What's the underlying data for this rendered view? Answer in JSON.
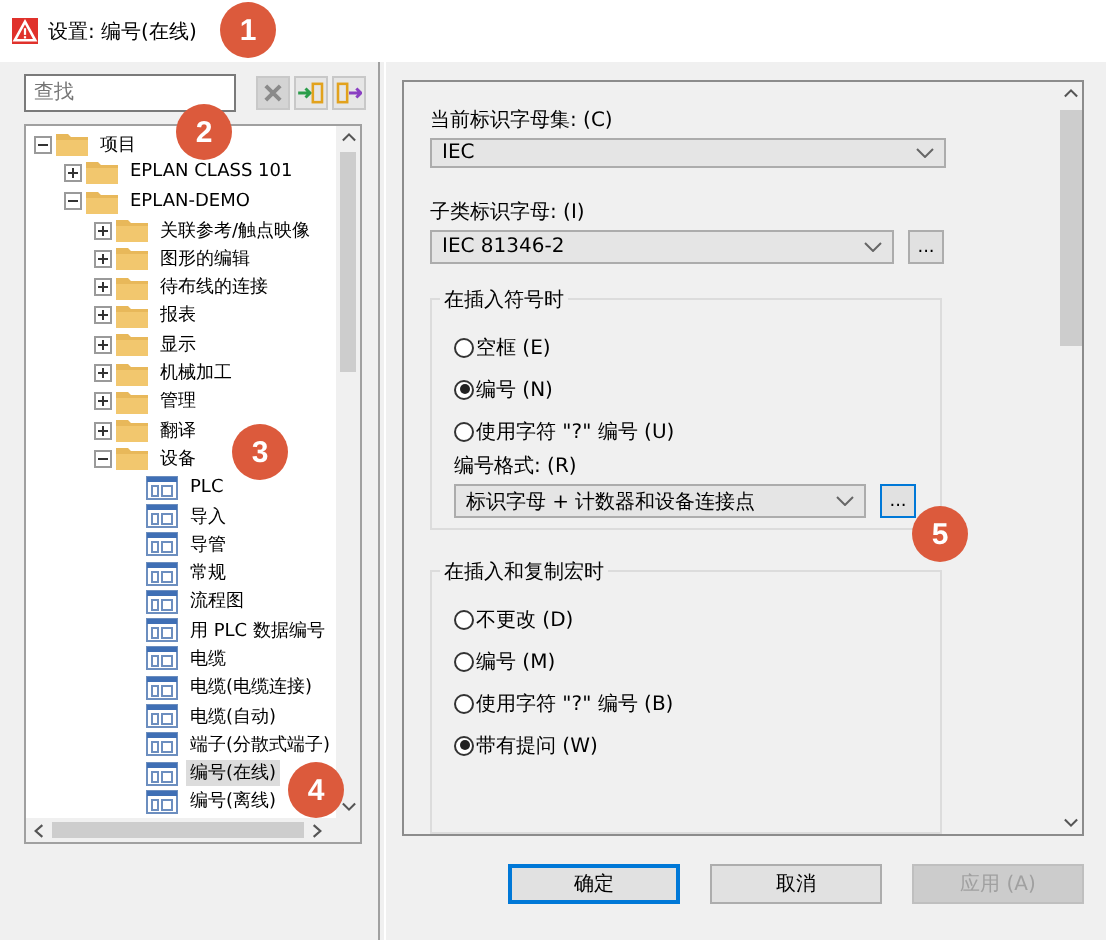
{
  "window": {
    "title": "设置: 编号(在线)"
  },
  "search": {
    "placeholder": "查找"
  },
  "tree": [
    {
      "label": "项目",
      "kind": "folder",
      "expanded": true,
      "selected": false,
      "children": [
        {
          "label": "EPLAN CLASS 101",
          "kind": "folder",
          "expanded": false,
          "selected": false
        },
        {
          "label": "EPLAN-DEMO",
          "kind": "folder",
          "expanded": true,
          "selected": false,
          "children": [
            {
              "label": "关联参考/触点映像",
              "kind": "folder",
              "expanded": false,
              "selected": false
            },
            {
              "label": "图形的编辑",
              "kind": "folder",
              "expanded": false,
              "selected": false
            },
            {
              "label": "待布线的连接",
              "kind": "folder",
              "expanded": false,
              "selected": false
            },
            {
              "label": "报表",
              "kind": "folder",
              "expanded": false,
              "selected": false
            },
            {
              "label": "显示",
              "kind": "folder",
              "expanded": false,
              "selected": false
            },
            {
              "label": "机械加工",
              "kind": "folder",
              "expanded": false,
              "selected": false
            },
            {
              "label": "管理",
              "kind": "folder",
              "expanded": false,
              "selected": false
            },
            {
              "label": "翻译",
              "kind": "folder",
              "expanded": false,
              "selected": false
            },
            {
              "label": "设备",
              "kind": "folder",
              "expanded": true,
              "selected": false,
              "children": [
                {
                  "label": "PLC",
                  "kind": "page",
                  "selected": false
                },
                {
                  "label": "导入",
                  "kind": "page",
                  "selected": false
                },
                {
                  "label": "导管",
                  "kind": "page",
                  "selected": false
                },
                {
                  "label": "常规",
                  "kind": "page",
                  "selected": false
                },
                {
                  "label": "流程图",
                  "kind": "page",
                  "selected": false
                },
                {
                  "label": "用 PLC 数据编号",
                  "kind": "page",
                  "selected": false
                },
                {
                  "label": "电缆",
                  "kind": "page",
                  "selected": false
                },
                {
                  "label": "电缆(电缆连接)",
                  "kind": "page",
                  "selected": false
                },
                {
                  "label": "电缆(自动)",
                  "kind": "page",
                  "selected": false
                },
                {
                  "label": "端子(分散式端子)",
                  "kind": "page",
                  "selected": false
                },
                {
                  "label": "编号(在线)",
                  "kind": "page",
                  "selected": true
                },
                {
                  "label": "编号(离线)",
                  "kind": "page",
                  "selected": false
                }
              ]
            }
          ]
        }
      ]
    }
  ],
  "letter_set": {
    "label": "当前标识字母集: (C)",
    "value": "IEC"
  },
  "subclass": {
    "label": "子类标识字母: (I)",
    "value": "IEC 81346-2",
    "more": "..."
  },
  "insert_symbol": {
    "title": "在插入符号时",
    "options": [
      {
        "label": "空框 (E)",
        "selected": false
      },
      {
        "label": "编号 (N)",
        "selected": true
      },
      {
        "label": "使用字符 \"?\" 编号 (U)",
        "selected": false
      }
    ],
    "format": {
      "label": "编号格式: (R)",
      "value": "标识字母 + 计数器和设备连接点",
      "more": "..."
    }
  },
  "insert_macro": {
    "title": "在插入和复制宏时",
    "options": [
      {
        "label": "不更改 (D)",
        "selected": false
      },
      {
        "label": "编号 (M)",
        "selected": false
      },
      {
        "label": "使用字符 \"?\" 编号 (B)",
        "selected": false
      },
      {
        "label": "带有提问 (W)",
        "selected": true
      }
    ]
  },
  "buttons": [
    {
      "label": "确定",
      "kind": "default",
      "disabled": false
    },
    {
      "label": "取消",
      "kind": "normal",
      "disabled": false
    },
    {
      "label": "应用 (A)",
      "kind": "normal",
      "disabled": true
    }
  ],
  "callouts": [
    "1",
    "2",
    "3",
    "4",
    "5"
  ]
}
